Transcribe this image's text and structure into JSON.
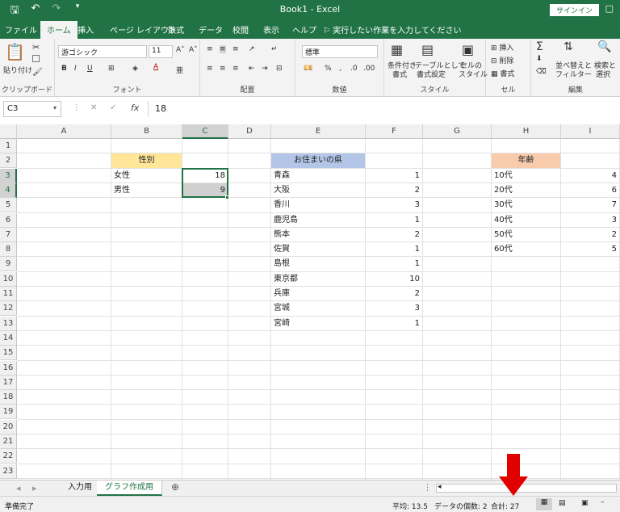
{
  "titlebar": {
    "title": "Book1 - Excel",
    "signin": "サインイン",
    "save_icon": "save-icon",
    "undo_icon": "undo-icon",
    "redo_icon": "redo-icon"
  },
  "tabs": [
    "ファイル",
    "ホーム",
    "挿入",
    "ページ レイアウト",
    "数式",
    "データ",
    "校閲",
    "表示",
    "ヘルプ"
  ],
  "tell_me": "実行したい作業を入力してください",
  "ribbon": {
    "clipboard": {
      "label": "クリップボード",
      "paste": "貼り付け"
    },
    "font": {
      "label": "フォント",
      "name": "游ゴシック",
      "size": "11"
    },
    "alignment": {
      "label": "配置"
    },
    "number": {
      "label": "数値",
      "format": "標準"
    },
    "styles": {
      "label": "スタイル",
      "conditional": "条件付き",
      "conditional2": "書式",
      "table": "テーブルとして",
      "table2": "書式設定",
      "cell_styles": "セルの",
      "cell_styles2": "スタイル"
    },
    "cells": {
      "label": "セル",
      "insert": "挿入",
      "delete": "削除",
      "format": "書式"
    },
    "editing": {
      "label": "編集",
      "sort": "並べ替えと",
      "sort2": "フィルター",
      "find": "検索と",
      "find2": "選択"
    }
  },
  "formula_bar": {
    "name_box": "C3",
    "formula": "18",
    "fx": "fx"
  },
  "grid": {
    "columns": [
      "A",
      "B",
      "C",
      "D",
      "E",
      "F",
      "G",
      "H",
      "I"
    ],
    "rows": [
      "1",
      "2",
      "3",
      "4",
      "5",
      "6",
      "7",
      "8",
      "9",
      "10",
      "11",
      "12",
      "13",
      "14",
      "15",
      "16",
      "17",
      "18",
      "19",
      "20",
      "21",
      "22",
      "23"
    ],
    "gender_header": "性別",
    "gender": [
      {
        "label": "女性",
        "value": "18"
      },
      {
        "label": "男性",
        "value": "9"
      }
    ],
    "pref_header": "お住まいの県",
    "prefectures": [
      {
        "label": "青森",
        "value": "1"
      },
      {
        "label": "大阪",
        "value": "2"
      },
      {
        "label": "香川",
        "value": "3"
      },
      {
        "label": "鹿児島",
        "value": "1"
      },
      {
        "label": "熊本",
        "value": "2"
      },
      {
        "label": "佐賀",
        "value": "1"
      },
      {
        "label": "島根",
        "value": "1"
      },
      {
        "label": "東京都",
        "value": "10"
      },
      {
        "label": "兵庫",
        "value": "2"
      },
      {
        "label": "宮城",
        "value": "3"
      },
      {
        "label": "宮崎",
        "value": "1"
      }
    ],
    "age_header": "年齢",
    "ages": [
      {
        "label": "10代",
        "value": "4"
      },
      {
        "label": "20代",
        "value": "6"
      },
      {
        "label": "30代",
        "value": "7"
      },
      {
        "label": "40代",
        "value": "3"
      },
      {
        "label": "50代",
        "value": "2"
      },
      {
        "label": "60代",
        "value": "5"
      }
    ],
    "colors": {
      "gender_header_bg": "#ffe699",
      "pref_header_bg": "#b4c6e7",
      "age_header_bg": "#f8cbad",
      "selection": "#217346"
    }
  },
  "sheets": [
    {
      "name": "入力用",
      "active": false
    },
    {
      "name": "グラフ作成用",
      "active": true
    }
  ],
  "status": {
    "ready": "準備完了",
    "average": "平均: 13.5",
    "count": "データの個数: 2",
    "sum": "合計: 27"
  },
  "annotation": {
    "arrow_color": "#e00000"
  }
}
